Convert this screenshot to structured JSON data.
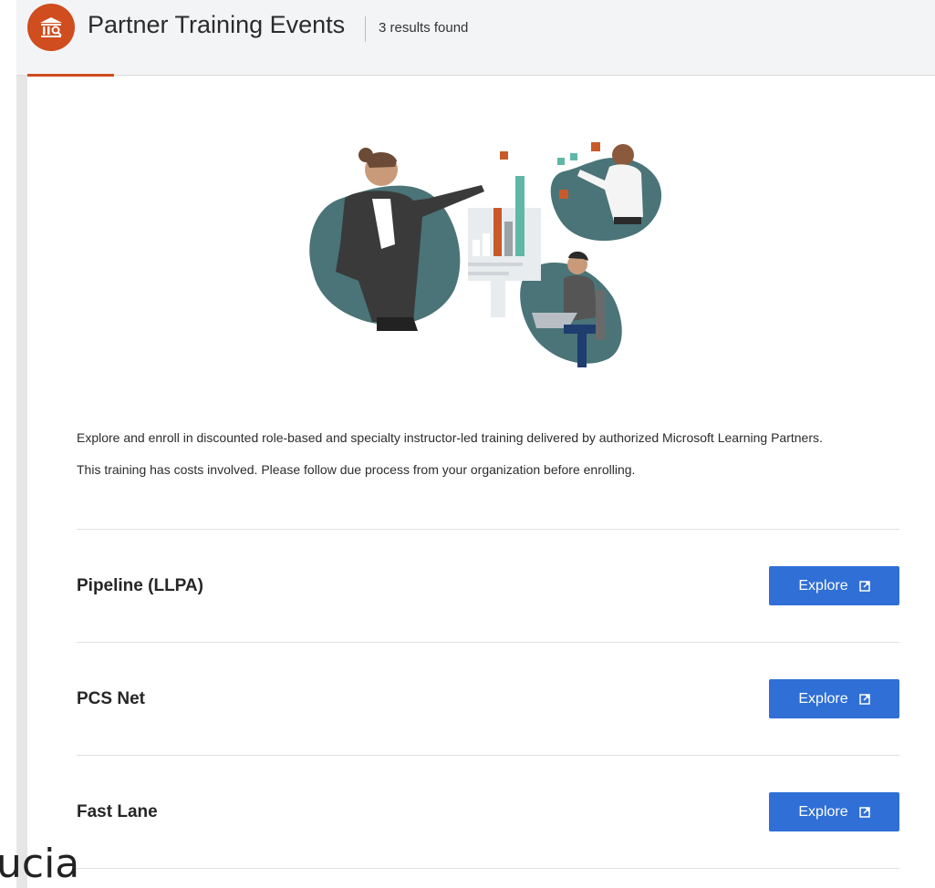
{
  "header": {
    "title": "Partner Training Events",
    "results": "3 results found",
    "icon": "classroom-icon"
  },
  "intro": {
    "line1": "Explore and enroll in discounted role-based and specialty instructor-led training delivered by authorized Microsoft Learning Partners.",
    "line2": "This training has costs involved. Please follow due process from your organization before enrolling."
  },
  "partners": [
    {
      "name": "Pipeline (LLPA)",
      "button": "Explore"
    },
    {
      "name": "PCS Net",
      "button": "Explore"
    },
    {
      "name": "Fast Lane",
      "button": "Explore"
    }
  ],
  "footer_text": "ucia",
  "colors": {
    "accent": "#cf4d1e",
    "button": "#2f6fd6",
    "blob": "#4a7478"
  }
}
